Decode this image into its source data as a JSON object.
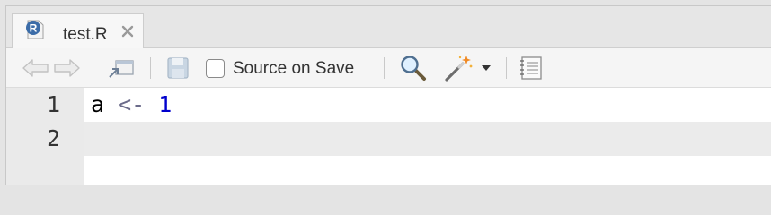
{
  "tab": {
    "label": "test.R",
    "icon": "r-file-icon",
    "close_icon": "close-icon"
  },
  "toolbar": {
    "back_icon": "back-arrow-icon",
    "forward_icon": "forward-arrow-icon",
    "show_in_window_icon": "show-in-new-window-icon",
    "save_icon": "save-icon",
    "source_on_save_label": "Source on Save",
    "source_on_save_checked": false,
    "find_icon": "magnifier-icon",
    "code_tools_icon": "magic-wand-icon",
    "dropdown_icon": "caret-down-icon",
    "compile_report_icon": "notebook-icon"
  },
  "editor": {
    "line_numbers": [
      "1",
      "2"
    ],
    "lines": [
      {
        "identifier": "a",
        "operator": "<-",
        "number": "1"
      },
      {
        "identifier": "",
        "operator": "",
        "number": ""
      }
    ],
    "colors": {
      "operator": "#6b6b8a",
      "number": "#0000cd"
    }
  }
}
